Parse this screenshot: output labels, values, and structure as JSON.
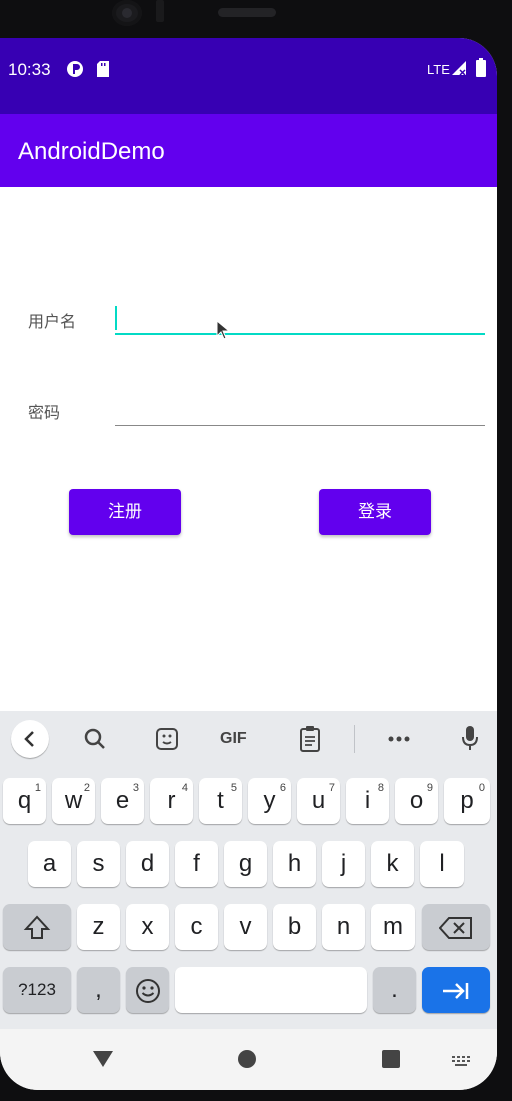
{
  "status_bar": {
    "time": "10:33",
    "network": "LTE"
  },
  "app_bar": {
    "title": "AndroidDemo"
  },
  "form": {
    "username_label": "用户名",
    "username_value": "",
    "password_label": "密码",
    "password_value": "",
    "register_label": "注册",
    "login_label": "登录"
  },
  "keyboard": {
    "toolbar": [
      "back",
      "search",
      "sticker",
      "GIF",
      "clipboard",
      "more",
      "mic"
    ],
    "gif_label": "GIF",
    "row1": [
      {
        "key": "q",
        "hint": "1"
      },
      {
        "key": "w",
        "hint": "2"
      },
      {
        "key": "e",
        "hint": "3"
      },
      {
        "key": "r",
        "hint": "4"
      },
      {
        "key": "t",
        "hint": "5"
      },
      {
        "key": "y",
        "hint": "6"
      },
      {
        "key": "u",
        "hint": "7"
      },
      {
        "key": "i",
        "hint": "8"
      },
      {
        "key": "o",
        "hint": "9"
      },
      {
        "key": "p",
        "hint": "0"
      }
    ],
    "row2": [
      "a",
      "s",
      "d",
      "f",
      "g",
      "h",
      "j",
      "k",
      "l"
    ],
    "row3": [
      "z",
      "x",
      "c",
      "v",
      "b",
      "n",
      "m"
    ],
    "symbols_label": "?123",
    "comma_label": ",",
    "period_label": "."
  },
  "colors": {
    "status_bar": "#3700b3",
    "primary": "#6200ee",
    "accent": "#03dac5",
    "keyboard_bg": "#e8eaed",
    "enter_key": "#1a73e8"
  }
}
